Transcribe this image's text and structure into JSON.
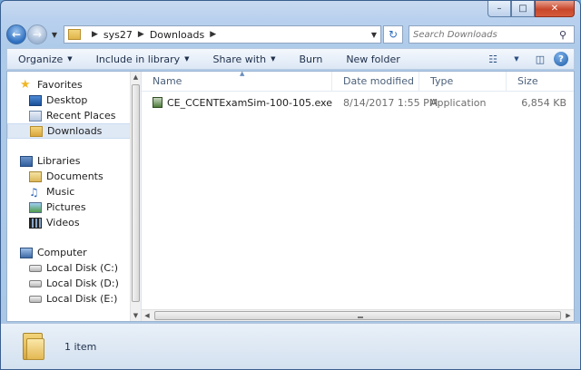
{
  "window": {
    "min_icon": "minimize-icon",
    "max_icon": "maximize-icon",
    "close_icon": "close-icon"
  },
  "address": {
    "crumbs": [
      "sys27",
      "Downloads"
    ],
    "search_placeholder": "Search Downloads"
  },
  "toolbar": {
    "organize": "Organize",
    "include": "Include in library",
    "share": "Share with",
    "burn": "Burn",
    "new_folder": "New folder"
  },
  "nav": {
    "favorites": "Favorites",
    "desktop": "Desktop",
    "recent": "Recent Places",
    "downloads": "Downloads",
    "libraries": "Libraries",
    "documents": "Documents",
    "music": "Music",
    "pictures": "Pictures",
    "videos": "Videos",
    "computer": "Computer",
    "disk_c": "Local Disk (C:)",
    "disk_d": "Local Disk (D:)",
    "disk_e": "Local Disk (E:)"
  },
  "columns": {
    "name": "Name",
    "date": "Date modified",
    "type": "Type",
    "size": "Size"
  },
  "files": [
    {
      "name": "CE_CCENTExamSim-100-105.exe",
      "date": "8/14/2017 1:55 PM",
      "type": "Application",
      "size": "6,854 KB"
    }
  ],
  "details": {
    "count": "1 item"
  },
  "colors": {
    "selected_bg": "#dfe9f6",
    "frame": "#aecbe9"
  }
}
